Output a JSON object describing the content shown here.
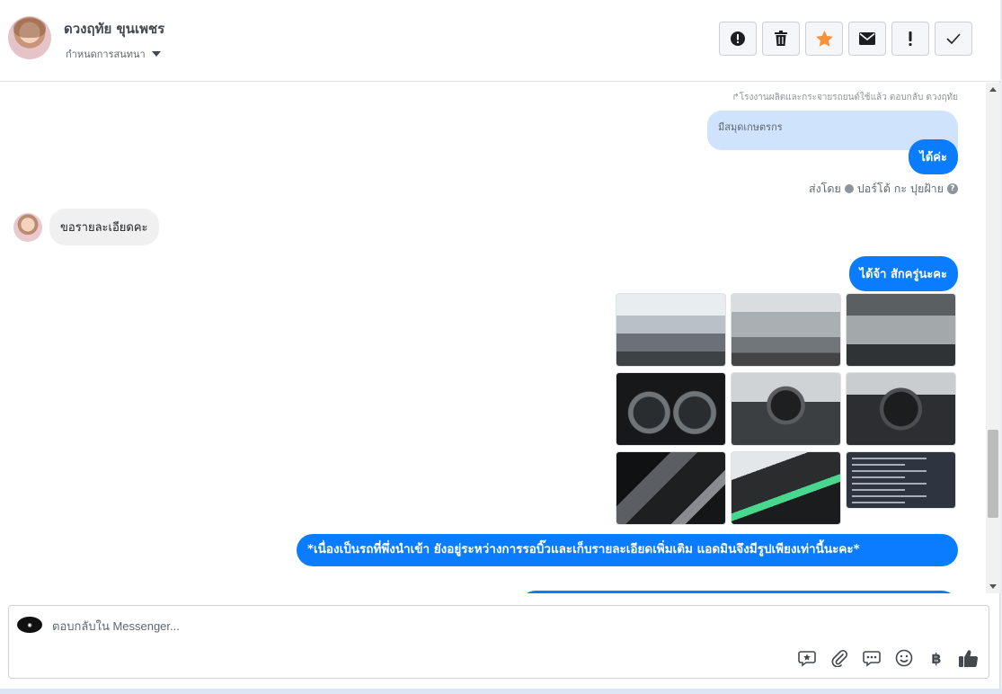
{
  "header": {
    "contact_name": "ดวงฤทัย ขุนเพชร",
    "assign_label": "กำหนดการสนทนา",
    "toolbar": [
      {
        "name": "spam-button",
        "icon": "alert-circle-icon"
      },
      {
        "name": "delete-button",
        "icon": "trash-icon"
      },
      {
        "name": "star-button",
        "icon": "star-icon",
        "color": "#f7923b"
      },
      {
        "name": "mark-unread-button",
        "icon": "envelope-icon"
      },
      {
        "name": "follow-up-button",
        "icon": "exclamation-icon"
      },
      {
        "name": "mark-done-button",
        "icon": "check-icon"
      }
    ]
  },
  "conversation": {
    "reply_meta": "โรงงานผลิตและกระจายรถยนต์ใช้แล้ว ตอบกลับ ดวงฤทัย",
    "quoted_text": "มีสมุดเกษตรกร",
    "messages": [
      {
        "direction": "out",
        "text": "ได้ค่ะ"
      },
      {
        "direction": "in",
        "text": "ขอรายละเอียดคะ"
      },
      {
        "direction": "out",
        "text": "ได้จ้า สักครู่นะคะ"
      },
      {
        "direction": "out",
        "text": "*เนื่องเป็นรถที่พึ่งนำเข้า ยังอยู่ระหว่างการรอบิ๊วและเก็บรายละเอียดเพิ่มเติม แอดมินจึงมีรูปเพียงเท่านี้นะคะ*"
      }
    ],
    "sent_by_label": "ส่งโดย",
    "sent_by_name": "ปอร์โต้ กะ ปุยฝ้าย",
    "photo_count": 9
  },
  "composer": {
    "placeholder": "ตอบกลับใน Messenger...",
    "tools": [
      {
        "name": "saved-reply-button",
        "icon": "star-chat-icon"
      },
      {
        "name": "attach-button",
        "icon": "paperclip-icon"
      },
      {
        "name": "quick-replies-button",
        "icon": "chat-dots-icon"
      },
      {
        "name": "emoji-button",
        "icon": "smiley-icon"
      },
      {
        "name": "payment-button",
        "icon": "baht-icon",
        "glyph": "฿"
      },
      {
        "name": "like-button",
        "icon": "thumbs-up-icon"
      }
    ]
  },
  "colors": {
    "accent": "#0a7cff",
    "quoted_bg": "#cfe3fd",
    "incoming_bg": "#f0f0f0"
  }
}
